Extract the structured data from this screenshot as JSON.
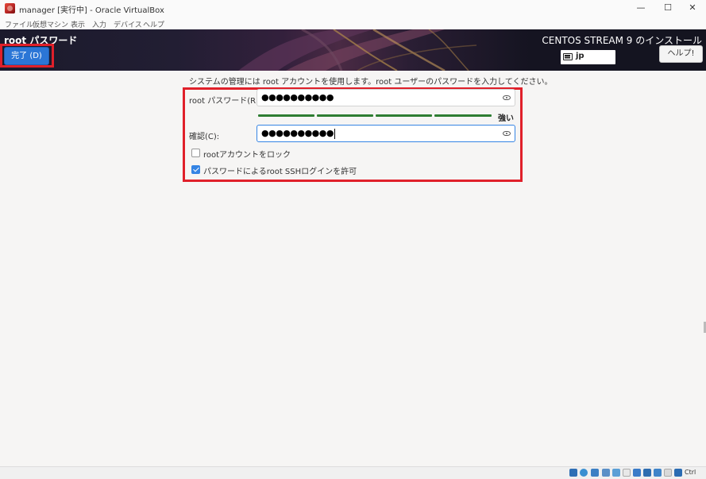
{
  "window": {
    "title": "manager [実行中] - Oracle VirtualBox",
    "controls": {
      "minimize": "—",
      "maximize": "☐",
      "close": "✕"
    }
  },
  "menu": [
    "ファイル",
    "仮想マシン",
    "表示",
    "入力",
    "デバイス",
    "ヘルプ"
  ],
  "header": {
    "page_title": "root パスワード",
    "done_label": "完了 (D)",
    "product_title": "CENTOS STREAM 9 のインストール",
    "keyboard_layout": "jp",
    "help_label": "ヘルプ!"
  },
  "form": {
    "description": "システムの管理には root アカウントを使用します。root ユーザーのパスワードを入力してください。",
    "password_label": "root パスワード(R):",
    "password_value": "●●●●●●●●●●",
    "strength_label": "強い",
    "strength_level": 1.0,
    "confirm_label": "確認(C):",
    "confirm_value": "●●●●●●●●●●",
    "lock_root_label": "rootアカウントをロック",
    "lock_root_checked": false,
    "allow_ssh_label": "パスワードによるroot SSHログインを許可",
    "allow_ssh_checked": true
  },
  "statusbar": {
    "host_key": "Ctrl",
    "icons": [
      "hard-disk-icon",
      "optical-drive-icon",
      "audio-icon",
      "network-icon",
      "usb-icon",
      "shared-folders-icon",
      "display-icon",
      "video-capture-icon",
      "cpu-icon",
      "mouse-integration-icon",
      "arrow-down-icon"
    ]
  },
  "colors": {
    "accent": "#3584e4",
    "done_button": "#2b76d6",
    "highlight_box": "#e0202a",
    "strength_bar": "#2e7d32"
  }
}
